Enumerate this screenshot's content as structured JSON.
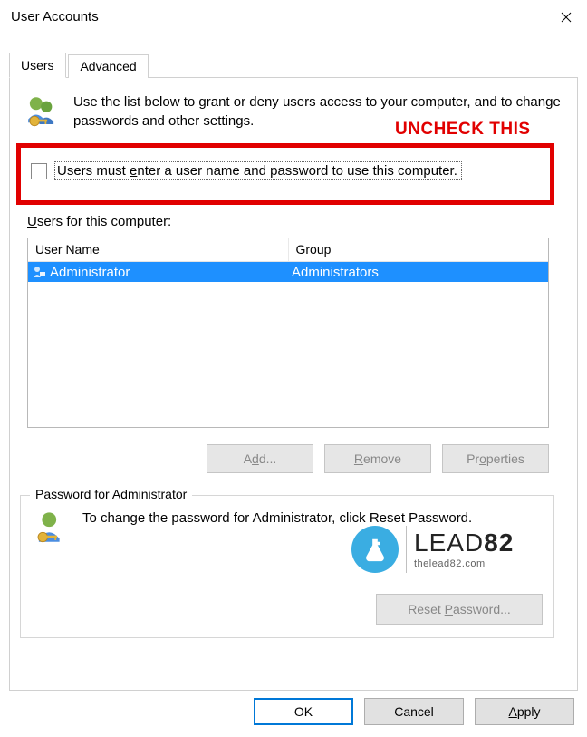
{
  "window": {
    "title": "User Accounts"
  },
  "tabs": [
    {
      "label": "Users",
      "active": true
    },
    {
      "label": "Advanced",
      "active": false
    }
  ],
  "intro": {
    "text": "Use the list below to grant or deny users access to your computer, and to change passwords and other settings."
  },
  "annotation": {
    "label": "UNCHECK THIS"
  },
  "checkbox": {
    "prefix": "Users must ",
    "underlined": "e",
    "rest": "nter a user name and password to use this computer."
  },
  "users": {
    "heading_prefix": "U",
    "heading_rest": "sers for this computer:",
    "columns": [
      "User Name",
      "Group"
    ],
    "rows": [
      {
        "username": "Administrator",
        "group": "Administrators"
      }
    ]
  },
  "buttons": {
    "add": "Add...",
    "remove_prefix": "R",
    "remove_rest": "emove",
    "properties_prefix": "Pr",
    "properties_rest": "operties"
  },
  "password_section": {
    "legend": "Password for Administrator",
    "text": "To change the password for Administrator, click Reset Password.",
    "reset_prefix": "Reset ",
    "reset_underlined": "P",
    "reset_rest": "assword..."
  },
  "dialog_buttons": {
    "ok": "OK",
    "cancel": "Cancel",
    "apply_prefix": "A",
    "apply_rest": "pply"
  },
  "watermark": {
    "brand_light": "LEAD",
    "brand_bold": "82",
    "sub": "thelead82.com"
  }
}
